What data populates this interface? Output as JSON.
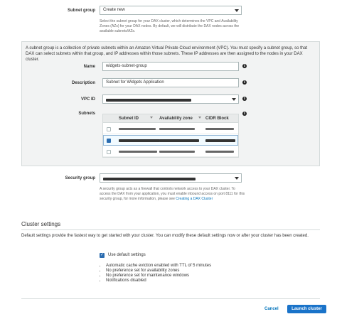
{
  "subnet_group": {
    "label": "Subnet group",
    "selected": "Create new",
    "help": "Select the subnet group for your DAX cluster, which determines the VPC and Availability Zones (AZs) for your DAX nodes. By default, we will distribute the DAX nodes across the available subnets/AZs."
  },
  "panel": {
    "description": "A subnet group is a collection of private subnets within an Amazon Virtual Private Cloud environment (VPC). You must specify a subnet group, so that DAX can select subnets within that group, and IP addresses within those subnets. These IP addresses are then assigned to the nodes in your DAX cluster.",
    "name_label": "Name",
    "name_value": "widgets-subnet-group",
    "description_label": "Description",
    "description_value": "Subnet for Widgets Application",
    "vpc_label": "VPC ID",
    "subnets_label": "Subnets",
    "subnet_columns": [
      "Subnet ID",
      "Availability zone",
      "CIDR Block"
    ],
    "subnet_rows": [
      {
        "checked": false
      },
      {
        "checked": true
      },
      {
        "checked": false
      }
    ]
  },
  "security_group": {
    "label": "Security group",
    "help": "A security group acts as a firewall that controls network access to your DAX cluster. To access the DAX from your application, you must enable inbound access on port 8111 for this security group, for more information, please see ",
    "help_link": "Creating a DAX Cluster"
  },
  "cluster_settings": {
    "heading": "Cluster settings",
    "description": "Default settings provide the fastest way to get started with your cluster. You can modify these default settings now or after your cluster has been created.",
    "use_default_label": "Use default settings",
    "use_default_checked": true,
    "defaults": [
      "Automatic cache eviction enabled with TTL of 5 minutes",
      "No preference set for availability zones",
      "No preference set for maintenance windows",
      "Notifications disabled"
    ]
  },
  "actions": {
    "cancel": "Cancel",
    "launch": "Launch cluster"
  },
  "colors": {
    "primary": "#1a73c9",
    "link": "#0073bb",
    "panel_bg": "#f2f3f3"
  }
}
